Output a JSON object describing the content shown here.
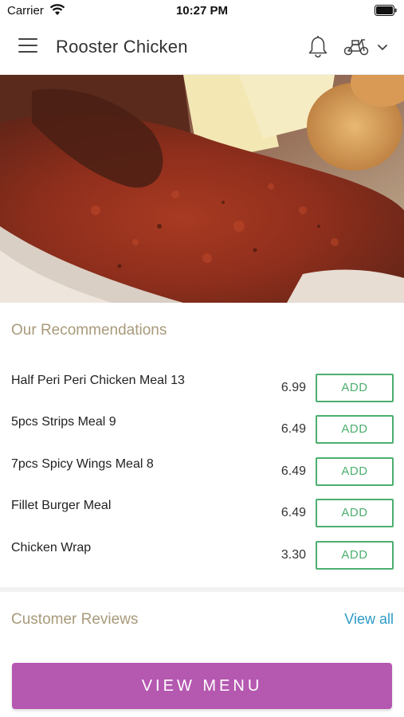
{
  "status_bar": {
    "carrier": "Carrier",
    "time": "10:27 PM"
  },
  "header": {
    "title": "Rooster Chicken",
    "icons": [
      "menu-icon",
      "bell-icon",
      "scooter-icon",
      "chevron-down-icon"
    ]
  },
  "hero": {
    "image": "food-photo"
  },
  "recommendations": {
    "title": "Our Recommendations",
    "add_label": "ADD",
    "items": [
      {
        "name": "Half Peri Peri Chicken Meal 13",
        "price": "6.99"
      },
      {
        "name": "5pcs Strips Meal 9",
        "price": "6.49"
      },
      {
        "name": "7pcs Spicy Wings Meal 8",
        "price": "6.49"
      },
      {
        "name": "Fillet Burger Meal",
        "price": "6.49"
      },
      {
        "name": "Chicken Wrap",
        "price": "3.30"
      }
    ]
  },
  "reviews": {
    "title": "Customer Reviews",
    "view_all": "View all"
  },
  "footer": {
    "view_menu": "VIEW MENU"
  },
  "colors": {
    "accent": "#b558b0",
    "add_green": "#4caf6e",
    "section_title": "#a89a7a",
    "link_blue": "#2b9bc7"
  }
}
